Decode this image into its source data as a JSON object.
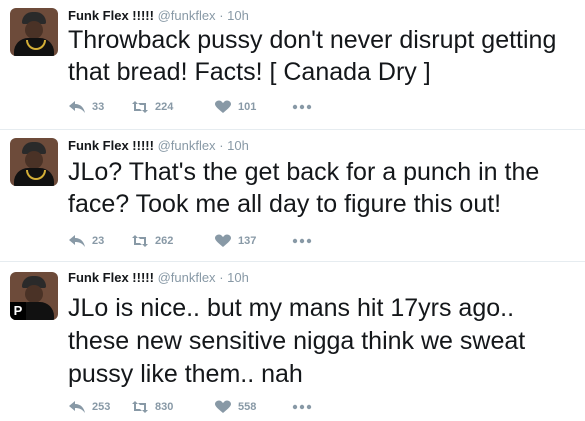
{
  "tweets": [
    {
      "name": "Funk Flex !!!!!",
      "handle": "@funkflex",
      "time": "· 10h",
      "text": "Throwback pussy don't never disrupt getting that bread! Facts! [ Canada Dry ]",
      "replies": "33",
      "retweets": "224",
      "likes": "101",
      "avatar_badge": ""
    },
    {
      "name": "Funk Flex !!!!!",
      "handle": "@funkflex",
      "time": "· 10h",
      "text": "JLo? That's the get back for a punch in the face? Took me all day to figure this out!",
      "replies": "23",
      "retweets": "262",
      "likes": "137",
      "avatar_badge": ""
    },
    {
      "name": "Funk Flex !!!!!",
      "handle": "@funkflex",
      "time": "· 10h",
      "text": "JLo is nice.. but my mans hit 17yrs ago.. these new sensitive nigga think we sweat pussy like them.. nah",
      "replies": "253",
      "retweets": "830",
      "likes": "558",
      "avatar_badge": "P"
    }
  ],
  "icons": {
    "reply": "reply-icon",
    "retweet": "retweet-icon",
    "like": "heart-icon",
    "more": "more-icon"
  },
  "colors": {
    "text": "#14171a",
    "muted": "#8899a6",
    "divider": "#e6ecf0"
  }
}
